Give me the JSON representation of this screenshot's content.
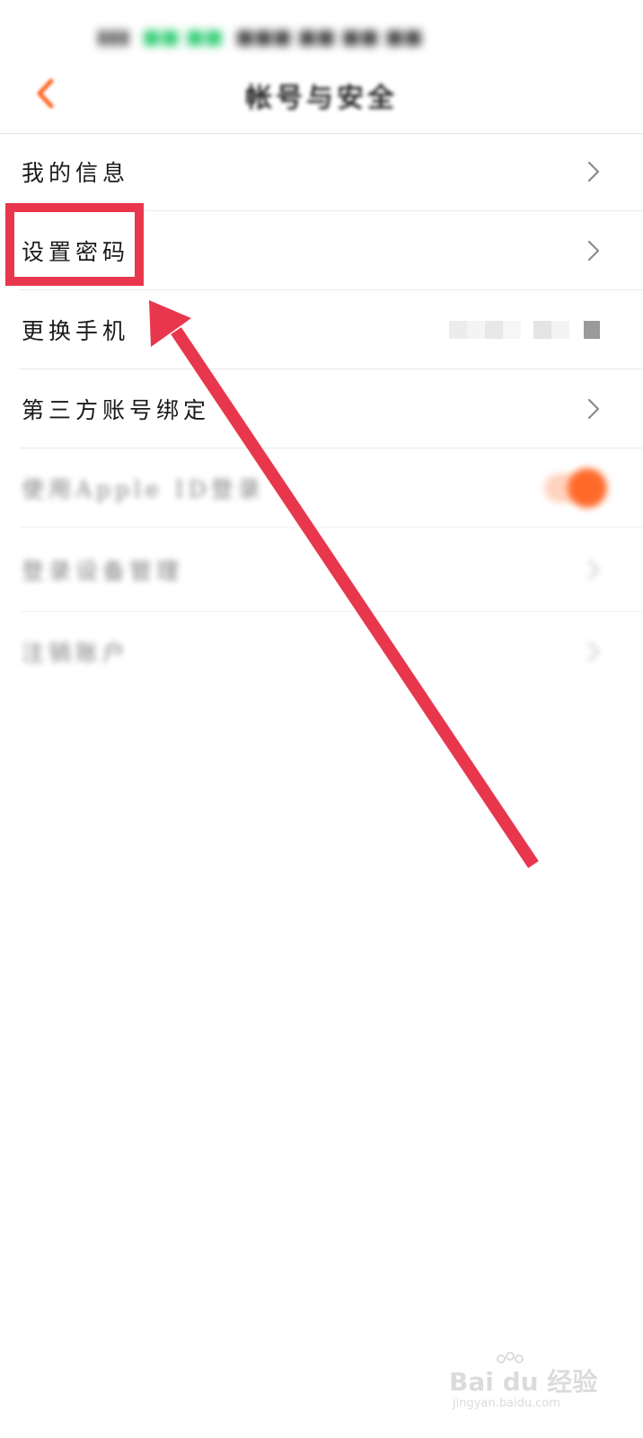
{
  "nav": {
    "title": "帐号与安全"
  },
  "settings": {
    "items": [
      {
        "label": "我的信息",
        "control": "chevron"
      },
      {
        "label": "设置密码",
        "control": "chevron"
      },
      {
        "label": "更换手机",
        "control": "masked-value"
      },
      {
        "label": "第三方账号绑定",
        "control": "chevron"
      },
      {
        "label": "使用Apple ID登录",
        "control": "toggle",
        "toggle_on": true
      },
      {
        "label": "登录设备管理",
        "control": "chevron"
      },
      {
        "label": "注销账户",
        "control": "chevron"
      }
    ]
  },
  "icons": {
    "back": "chevron-left-icon",
    "row_arrow": "chevron-right-icon"
  },
  "colors": {
    "accent": "#ff6a2b",
    "annotation": "#e8374d",
    "divider": "#e9e9e9"
  },
  "watermark": {
    "main": "Bai du 经验",
    "sub": "jingyan.baidu.com"
  }
}
